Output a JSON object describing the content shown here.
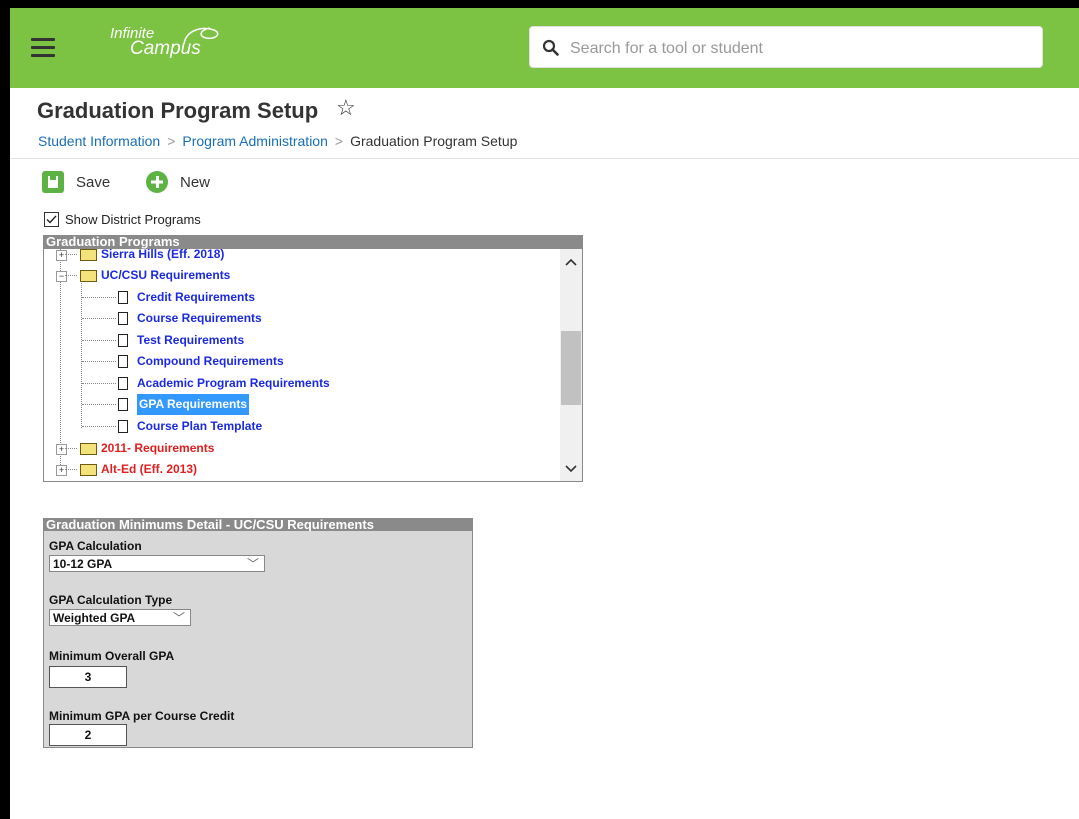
{
  "app": {
    "logo_line1": "Infinite",
    "logo_line2": "Campus"
  },
  "search": {
    "placeholder": "Search for a tool or student"
  },
  "page": {
    "title": "Graduation Program Setup",
    "breadcrumb": [
      "Student Information",
      "Program Administration",
      "Graduation Program Setup"
    ]
  },
  "toolbar": {
    "save_label": "Save",
    "new_label": "New"
  },
  "filter": {
    "show_district_label": "Show District Programs",
    "checked": true
  },
  "programs": {
    "header": "Graduation Programs",
    "items": [
      {
        "label": "Sierra Hills (Eff. 2018)",
        "type": "folder",
        "color": "#1b2adf",
        "expanded": false
      },
      {
        "label": "UC/CSU Requirements",
        "type": "folder",
        "color": "#1b2adf",
        "expanded": true
      },
      {
        "label": "Credit Requirements",
        "type": "doc"
      },
      {
        "label": "Course Requirements",
        "type": "doc"
      },
      {
        "label": "Test Requirements",
        "type": "doc"
      },
      {
        "label": "Compound Requirements",
        "type": "doc"
      },
      {
        "label": "Academic Program Requirements",
        "type": "doc"
      },
      {
        "label": "GPA Requirements",
        "type": "doc",
        "selected": true
      },
      {
        "label": "Course Plan Template",
        "type": "doc"
      },
      {
        "label": "2011- Requirements",
        "type": "folder",
        "color": "#e02020",
        "expanded": false
      },
      {
        "label": "Alt-Ed (Eff. 2013)",
        "type": "folder",
        "color": "#e02020",
        "expanded": false
      }
    ]
  },
  "detail": {
    "header": "Graduation Minimums Detail - UC/CSU Requirements",
    "gpa_calc_label": "GPA Calculation",
    "gpa_calc_value": "10-12 GPA",
    "gpa_type_label": "GPA Calculation Type",
    "gpa_type_value": "Weighted GPA",
    "min_overall_label": "Minimum Overall GPA",
    "min_overall_value": "3",
    "min_per_credit_label": "Minimum GPA per Course Credit",
    "min_per_credit_value": "2"
  },
  "colors": {
    "topbar": "#7cc243",
    "link": "#1b2adf",
    "inactive": "#e02020",
    "button": "#5cb343"
  }
}
